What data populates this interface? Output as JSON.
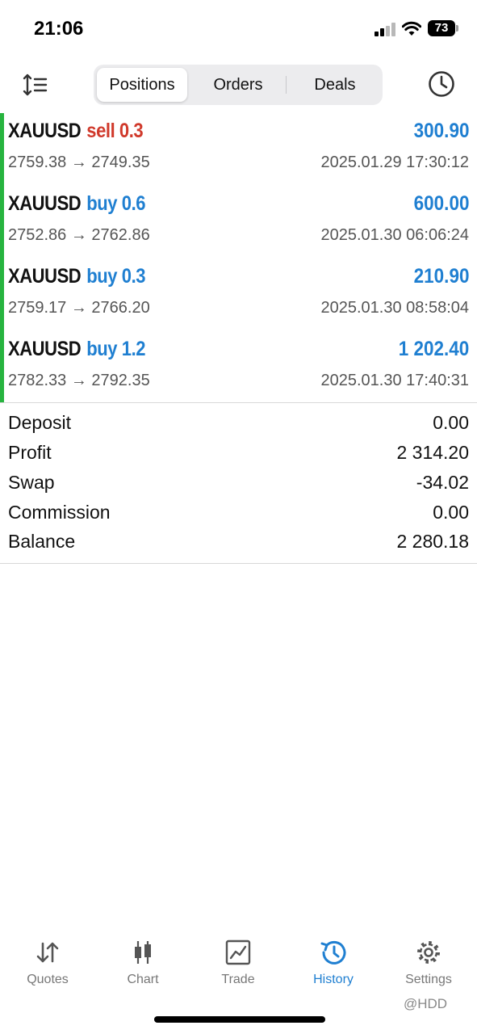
{
  "status_bar": {
    "time": "21:06",
    "battery": "73"
  },
  "header": {
    "tabs": [
      {
        "label": "Positions",
        "active": true
      },
      {
        "label": "Orders",
        "active": false
      },
      {
        "label": "Deals",
        "active": false
      }
    ],
    "left_icon": "sort-icon",
    "right_icon": "clock-icon"
  },
  "positions": [
    {
      "symbol": "XAUUSD",
      "side": "sell 0.3",
      "side_type": "sell",
      "profit": "300.90",
      "prices": "2759.38 → 2749.35",
      "date": "2025.01.29 17:30:12"
    },
    {
      "symbol": "XAUUSD",
      "side": "buy 0.6",
      "side_type": "buy",
      "profit": "600.00",
      "prices": "2752.86 → 2762.86",
      "date": "2025.01.30 06:06:24"
    },
    {
      "symbol": "XAUUSD",
      "side": "buy 0.3",
      "side_type": "buy",
      "profit": "210.90",
      "prices": "2759.17 → 2766.20",
      "date": "2025.01.30 08:58:04"
    },
    {
      "symbol": "XAUUSD",
      "side": "buy 1.2",
      "side_type": "buy",
      "profit": "1 202.40",
      "prices": "2782.33 → 2792.35",
      "date": "2025.01.30 17:40:31"
    }
  ],
  "summary": {
    "deposit_label": "Deposit",
    "deposit": "0.00",
    "profit_label": "Profit",
    "profit": "2 314.20",
    "swap_label": "Swap",
    "swap": "-34.02",
    "commission_label": "Commission",
    "commission": "0.00",
    "balance_label": "Balance",
    "balance": "2 280.18"
  },
  "tabbar": [
    {
      "label": "Quotes",
      "icon": "quotes-icon",
      "active": false
    },
    {
      "label": "Chart",
      "icon": "chart-icon",
      "active": false
    },
    {
      "label": "Trade",
      "icon": "trade-icon",
      "active": false
    },
    {
      "label": "History",
      "icon": "history-icon",
      "active": true
    },
    {
      "label": "Settings",
      "icon": "gear-icon",
      "active": false
    }
  ],
  "watermark": "@HDD",
  "colors": {
    "buy": "#1f7fd1",
    "sell": "#d0392b",
    "accent": "#1f7fd1",
    "profit_bar": "#27b43f"
  }
}
